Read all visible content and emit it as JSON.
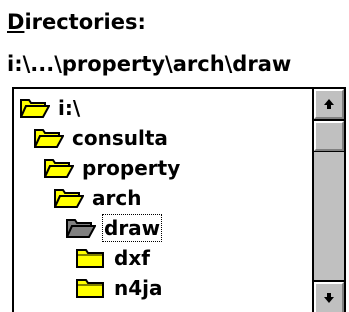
{
  "dialog": {
    "directories_label_hotkey": "D",
    "directories_label_rest": "irectories:",
    "current_path": "i:\\...\\property\\arch\\draw"
  },
  "directory_list": {
    "items": [
      {
        "label": "i:\\",
        "icon": "open-folder-icon"
      },
      {
        "label": "consulta",
        "icon": "open-folder-icon"
      },
      {
        "label": "property",
        "icon": "open-folder-icon"
      },
      {
        "label": "arch",
        "icon": "open-folder-icon"
      },
      {
        "label": "draw",
        "icon": "open-folder-selected-icon",
        "selected": true
      },
      {
        "label": "dxf",
        "icon": "closed-folder-icon"
      },
      {
        "label": "n4ja",
        "icon": "closed-folder-icon"
      }
    ]
  },
  "colors": {
    "folder_fill": "#ffff00",
    "folder_selected_fill": "#808080",
    "scrollbar_face": "#c0c0c0"
  }
}
